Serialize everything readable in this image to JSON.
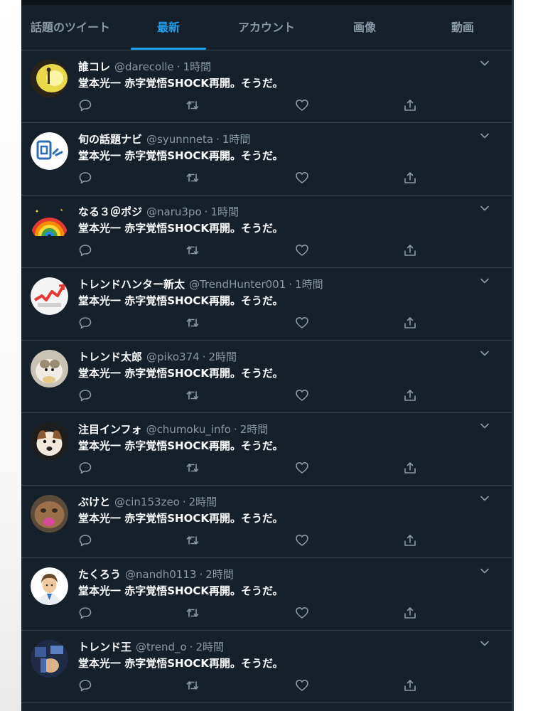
{
  "tabs": [
    {
      "label": "話題のツイート",
      "active": false
    },
    {
      "label": "最新",
      "active": true
    },
    {
      "label": "アカウント",
      "active": false
    },
    {
      "label": "画像",
      "active": false
    },
    {
      "label": "動画",
      "active": false
    }
  ],
  "tweets": [
    {
      "name": "誰コレ",
      "handle": "@darecolle",
      "separator": "·",
      "time": "1時間",
      "text": "堂本光一 赤字覚悟SHOCK再開。そうだ。"
    },
    {
      "name": "旬の話題ナビ",
      "handle": "@syunnneta",
      "separator": "·",
      "time": "1時間",
      "text": "堂本光一 赤字覚悟SHOCK再開。そうだ。"
    },
    {
      "name": "なる３＠ポジ",
      "handle": "@naru3po",
      "separator": "·",
      "time": "1時間",
      "text": "堂本光一 赤字覚悟SHOCK再開。そうだ。"
    },
    {
      "name": "トレンドハンター新太",
      "handle": "@TrendHunter001",
      "separator": "·",
      "time": "1時間",
      "text": "堂本光一 赤字覚悟SHOCK再開。そうだ。"
    },
    {
      "name": "トレンド太郎",
      "handle": "@piko374",
      "separator": "·",
      "time": "2時間",
      "text": "堂本光一 赤字覚悟SHOCK再開。そうだ。"
    },
    {
      "name": "注目インフォ",
      "handle": "@chumoku_info",
      "separator": "·",
      "time": "2時間",
      "text": "堂本光一 赤字覚悟SHOCK再開。そうだ。"
    },
    {
      "name": "ぶけと",
      "handle": "@cin153zeo",
      "separator": "·",
      "time": "2時間",
      "text": "堂本光一 赤字覚悟SHOCK再開。そうだ。"
    },
    {
      "name": "たくろう",
      "handle": "@nandh0113",
      "separator": "·",
      "time": "2時間",
      "text": "堂本光一 赤字覚悟SHOCK再開。そうだ。"
    },
    {
      "name": "トレンド王",
      "handle": "@trend_o",
      "separator": "·",
      "time": "2時間",
      "text": "堂本光一 赤字覚悟SHOCK再開。そうだ。"
    }
  ],
  "icons": {
    "reply": "reply-icon",
    "retweet": "retweet-icon",
    "like": "like-icon",
    "share": "share-icon",
    "more": "chevron-down-icon"
  },
  "colors": {
    "background": "#15202b",
    "accent": "#1da1f2",
    "text": "#ffffff",
    "secondary": "#8899a6",
    "border": "#38444d"
  }
}
